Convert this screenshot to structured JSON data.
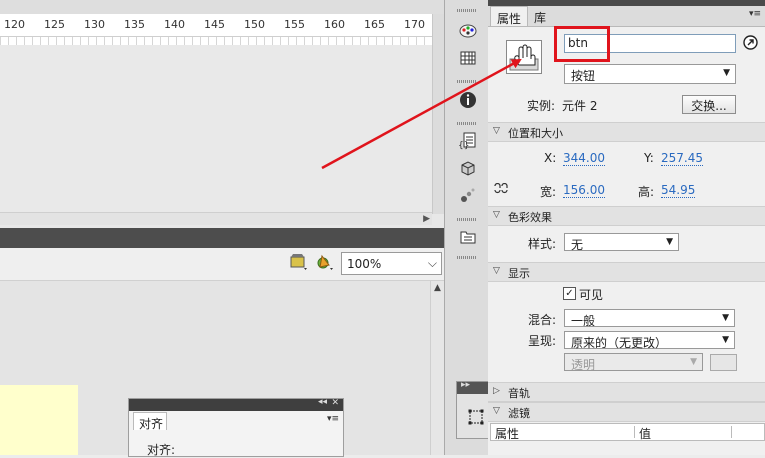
{
  "timeline": {
    "ruler_ticks": [
      "120",
      "125",
      "130",
      "135",
      "140",
      "145",
      "150",
      "155",
      "160",
      "165",
      "170"
    ]
  },
  "stage": {
    "zoom_value": "100%"
  },
  "align_panel": {
    "tab": "对齐",
    "label": "对齐:"
  },
  "properties": {
    "tabs": [
      "属性",
      "库"
    ],
    "instance_name": "btn",
    "symbol_type": "按钮",
    "instance_label": "实例:",
    "instance_of": "元件 2",
    "swap_button": "交换...",
    "section_position": "位置和大小",
    "x_label": "X:",
    "x_value": "344.00",
    "y_label": "Y:",
    "y_value": "257.45",
    "width_label": "宽:",
    "width_value": "156.00",
    "height_label": "高:",
    "height_value": "54.95",
    "section_color": "色彩效果",
    "style_label": "样式:",
    "style_value": "无",
    "section_display": "显示",
    "visible_label": "可见",
    "blend_label": "混合:",
    "blend_value": "一般",
    "render_label": "呈现:",
    "render_value": "原来的（无更改）",
    "transparent_value": "透明",
    "section_track": "音轨",
    "section_filter": "滤镜",
    "filter_col_property": "属性",
    "filter_col_value": "值"
  },
  "colors": {
    "highlight": "#e0141c",
    "canvas": "#ffffcc",
    "link_blue": "#2a6ac0"
  }
}
